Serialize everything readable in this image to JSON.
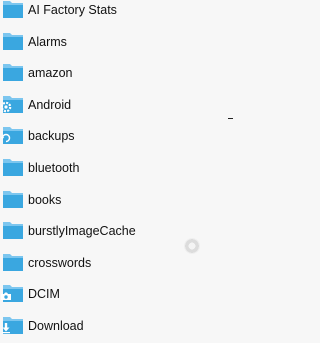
{
  "colors": {
    "background": "#f7f7f7",
    "folder_front": "#3aa7e0",
    "folder_back": "#7cc6ef",
    "text": "#111111"
  },
  "items": [
    {
      "label": "AI Factory Stats",
      "icon": "folder-icon"
    },
    {
      "label": "Alarms",
      "icon": "folder-icon"
    },
    {
      "label": "amazon",
      "icon": "folder-icon"
    },
    {
      "label": "Android",
      "icon": "folder-icon",
      "badge": "gear-icon"
    },
    {
      "label": "backups",
      "icon": "folder-icon",
      "badge": "backup-icon"
    },
    {
      "label": "bluetooth",
      "icon": "folder-icon"
    },
    {
      "label": "books",
      "icon": "folder-icon"
    },
    {
      "label": "burstlyImageCache",
      "icon": "folder-icon"
    },
    {
      "label": "crosswords",
      "icon": "folder-icon"
    },
    {
      "label": "DCIM",
      "icon": "folder-icon",
      "badge": "camera-icon"
    },
    {
      "label": "Download",
      "icon": "folder-icon",
      "badge": "download-icon"
    }
  ]
}
